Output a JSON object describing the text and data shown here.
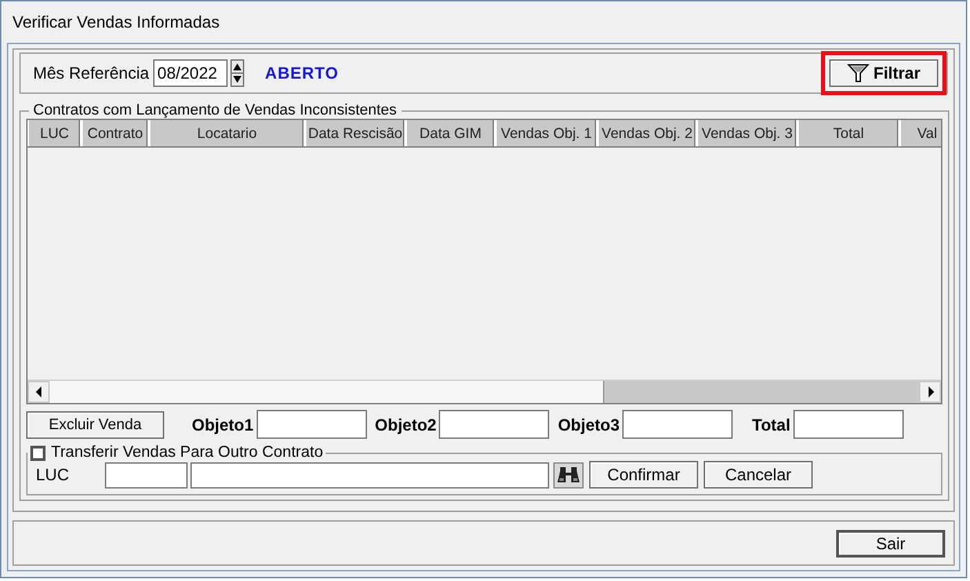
{
  "window": {
    "title": "Verificar Vendas Informadas"
  },
  "reference": {
    "label": "Mês Referência",
    "value": "08/2022",
    "status": "ABERTO"
  },
  "filter_button": {
    "label": "Filtrar",
    "highlighted": true
  },
  "grid": {
    "title": "Contratos com Lançamento de Vendas Inconsistentes",
    "columns": [
      {
        "label": "LUC"
      },
      {
        "label": "Contrato"
      },
      {
        "label": "Locatario"
      },
      {
        "label": "Data Rescisão"
      },
      {
        "label": "Data GIM"
      },
      {
        "label": "Vendas Obj. 1"
      },
      {
        "label": "Vendas Obj. 2"
      },
      {
        "label": "Vendas Obj. 3"
      },
      {
        "label": "Total"
      },
      {
        "label": "Val"
      }
    ]
  },
  "actions": {
    "delete_button": "Excluir Venda",
    "fields": [
      {
        "label": "Objeto1"
      },
      {
        "label": "Objeto2"
      },
      {
        "label": "Objeto3"
      },
      {
        "label": "Total"
      }
    ]
  },
  "transfer": {
    "label": "Transferir Vendas Para Outro Contrato",
    "checked": false,
    "luc_label": "LUC",
    "buttons": [
      "Confirmar",
      "Cancelar"
    ]
  },
  "exit_button": "Sair"
}
